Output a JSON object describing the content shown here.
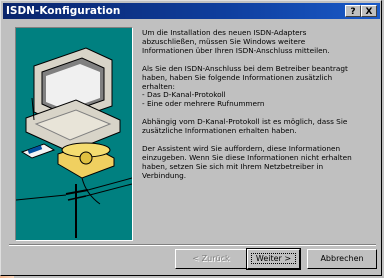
{
  "window": {
    "title": "ISDN-Konfiguration",
    "help_btn": "?",
    "close_btn": "X"
  },
  "content": {
    "paragraphs": [
      "Um die Installation des neuen ISDN-Adapters\nabzuschließen, müssen Sie Windows weitere\nInformationen über Ihren ISDN-Anschluss mitteilen.",
      "Als Sie den ISDN-Anschluss bei dem Betreiber beantragt\nhaben, haben Sie folgende Informationen zusätzlich\nerhalten:\n- Das D-Kanal-Protokoll\n- Eine oder mehrere Rufnummern",
      "Abhängig vom D-Kanal-Protokoll ist es möglich, dass Sie\nzusätzliche Informationen erhalten haben.",
      "Der Assistent wird Sie auffordern, diese Informationen\neinzugeben. Wenn Sie diese Informationen nicht erhalten\nhaben, setzen Sie sich mit Ihrem Netzbetreiber in\nVerbindung."
    ]
  },
  "buttons": {
    "back": "< Zurück",
    "next": "Weiter >",
    "cancel": "Abbrechen"
  },
  "icons": [
    "computer-icon",
    "telephone-icon",
    "isdn-card-icon",
    "telephone-pole-icon"
  ]
}
